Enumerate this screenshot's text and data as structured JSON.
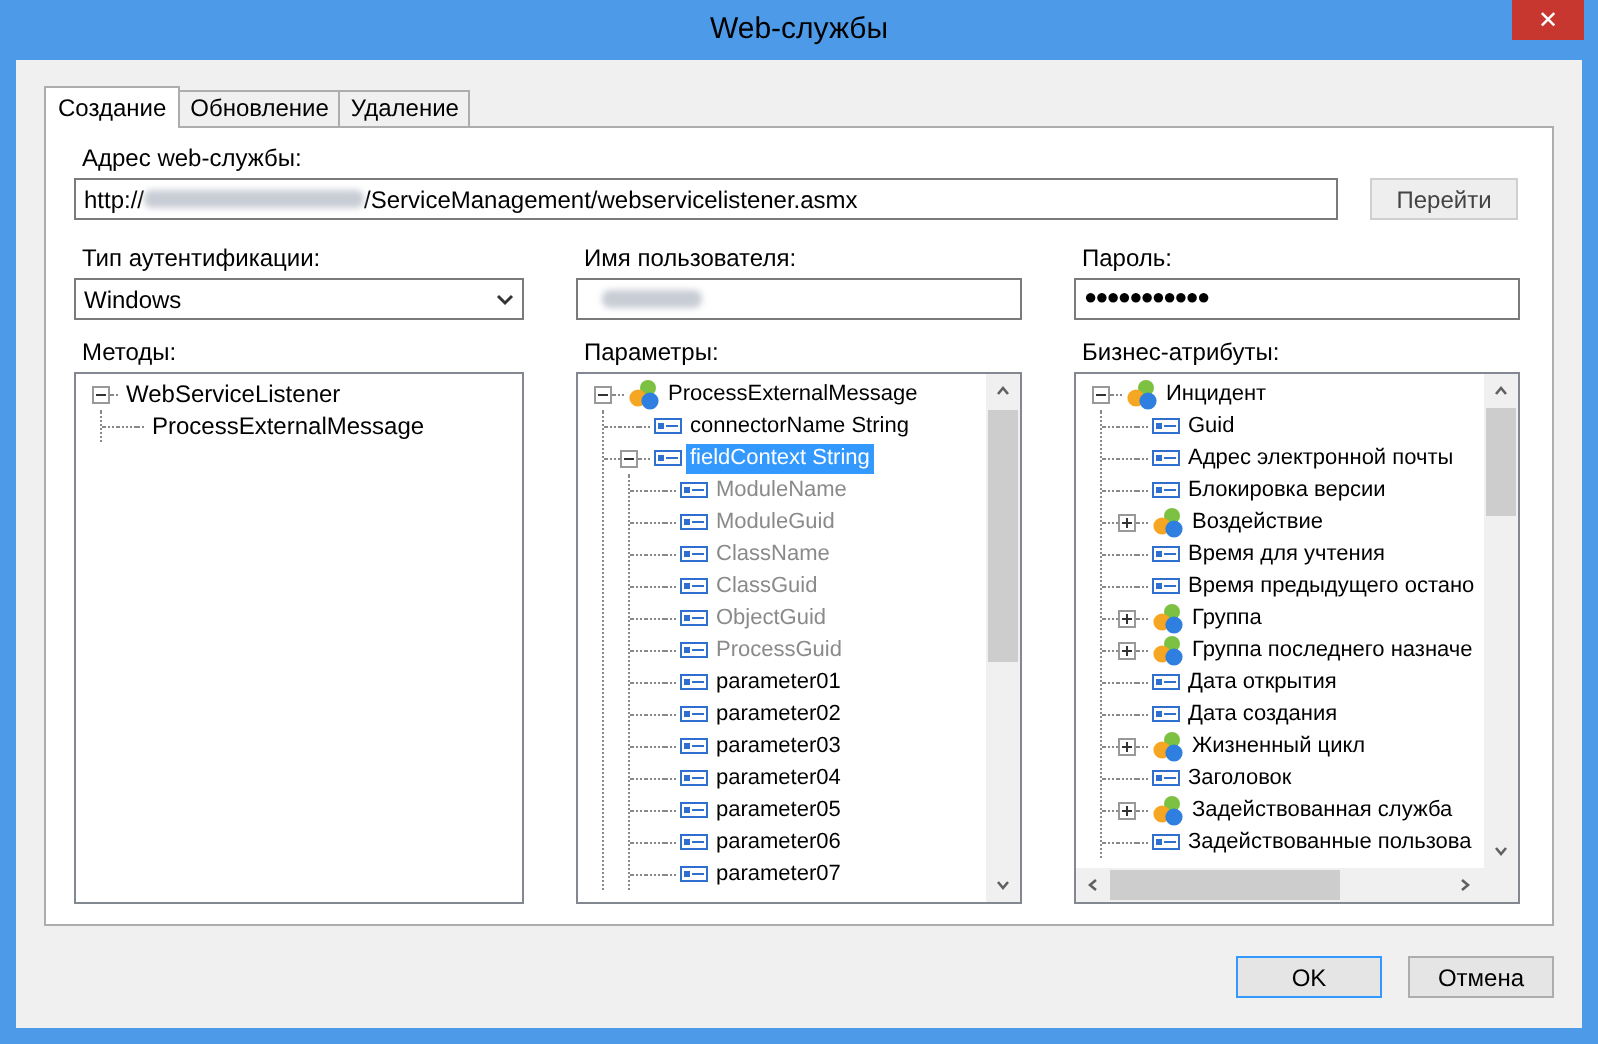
{
  "window": {
    "title": "Web-службы",
    "close": "✕"
  },
  "tabs": [
    {
      "label": "Создание",
      "selected": true
    },
    {
      "label": "Обновление",
      "selected": false
    },
    {
      "label": "Удаление",
      "selected": false
    }
  ],
  "address": {
    "label": "Адрес web-службы:",
    "value_start": "http://",
    "value_end": "/ServiceManagement/webservicelistener.asmx",
    "go_button": "Перейти"
  },
  "auth": {
    "label": "Тип аутентификации:",
    "value": "Windows"
  },
  "user": {
    "label": "Имя пользователя:"
  },
  "password": {
    "label": "Пароль:",
    "value": "●●●●●●●●●●●"
  },
  "methods": {
    "label": "Методы:",
    "tree": [
      {
        "label": "WebServiceListener",
        "kind": "plain",
        "expanded": true,
        "selected": false,
        "children": [
          {
            "label": "ProcessExternalMessage",
            "kind": "plain",
            "selected": false
          }
        ]
      }
    ]
  },
  "parameters": {
    "label": "Параметры:",
    "tree": [
      {
        "label": "ProcessExternalMessage",
        "kind": "object",
        "expanded": true,
        "selected": false,
        "disabled": false,
        "children": [
          {
            "label": "connectorName String",
            "kind": "field",
            "selected": false,
            "disabled": false
          },
          {
            "label": "fieldContext String",
            "kind": "field",
            "expanded": true,
            "selected": true,
            "disabled": false,
            "children": [
              {
                "label": "ModuleName",
                "kind": "field",
                "selected": false,
                "disabled": true
              },
              {
                "label": "ModuleGuid",
                "kind": "field",
                "selected": false,
                "disabled": true
              },
              {
                "label": "ClassName",
                "kind": "field",
                "selected": false,
                "disabled": true
              },
              {
                "label": "ClassGuid",
                "kind": "field",
                "selected": false,
                "disabled": true
              },
              {
                "label": "ObjectGuid",
                "kind": "field",
                "selected": false,
                "disabled": true
              },
              {
                "label": "ProcessGuid",
                "kind": "field",
                "selected": false,
                "disabled": true
              },
              {
                "label": "parameter01",
                "kind": "field",
                "selected": false,
                "disabled": false
              },
              {
                "label": "parameter02",
                "kind": "field",
                "selected": false,
                "disabled": false
              },
              {
                "label": "parameter03",
                "kind": "field",
                "selected": false,
                "disabled": false
              },
              {
                "label": "parameter04",
                "kind": "field",
                "selected": false,
                "disabled": false
              },
              {
                "label": "parameter05",
                "kind": "field",
                "selected": false,
                "disabled": false
              },
              {
                "label": "parameter06",
                "kind": "field",
                "selected": false,
                "disabled": false
              },
              {
                "label": "parameter07",
                "kind": "field",
                "selected": false,
                "disabled": false
              }
            ]
          }
        ]
      }
    ]
  },
  "business_attributes": {
    "label": "Бизнес-атрибуты:",
    "tree": [
      {
        "label": "Инцидент",
        "kind": "object",
        "expanded": true,
        "selected": false,
        "children": [
          {
            "label": "Guid",
            "kind": "field",
            "selected": false
          },
          {
            "label": "Адрес электронной почты",
            "kind": "field",
            "selected": false
          },
          {
            "label": "Блокировка версии",
            "kind": "field",
            "selected": false
          },
          {
            "label": "Воздействие",
            "kind": "object",
            "expanded": false,
            "selected": false
          },
          {
            "label": "Время для учтения",
            "kind": "field",
            "selected": false
          },
          {
            "label": "Время предыдущего остано",
            "kind": "field",
            "selected": false
          },
          {
            "label": "Группа",
            "kind": "object",
            "expanded": false,
            "selected": false
          },
          {
            "label": "Группа последнего назначе",
            "kind": "object",
            "expanded": false,
            "selected": false
          },
          {
            "label": "Дата открытия",
            "kind": "field",
            "selected": false
          },
          {
            "label": "Дата создания",
            "kind": "field",
            "selected": false
          },
          {
            "label": "Жизненный цикл",
            "kind": "object",
            "expanded": false,
            "selected": false
          },
          {
            "label": "Заголовок",
            "kind": "field",
            "selected": false
          },
          {
            "label": "Задействованная служба",
            "kind": "object",
            "expanded": false,
            "selected": false
          },
          {
            "label": "Задействованные пользова",
            "kind": "field",
            "selected": false
          }
        ]
      }
    ]
  },
  "buttons": [
    "OK",
    "Отмена"
  ]
}
